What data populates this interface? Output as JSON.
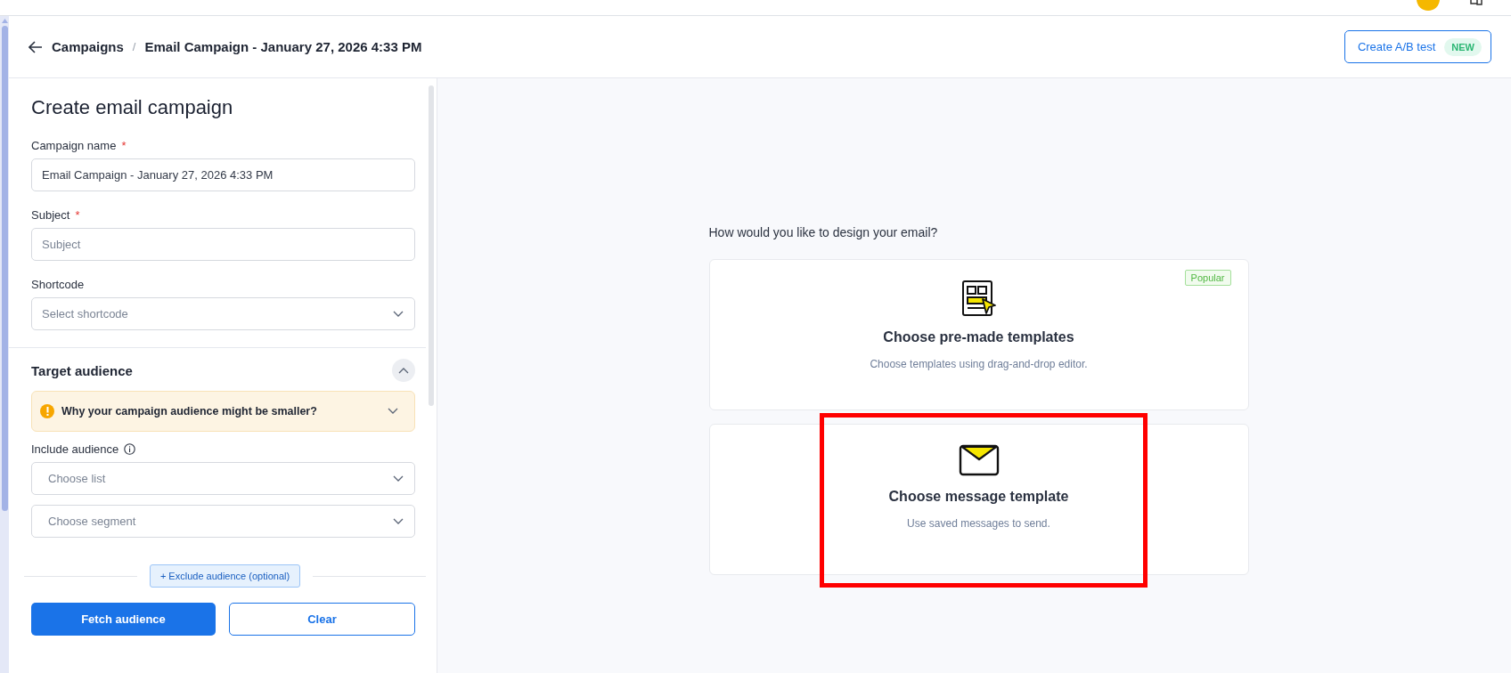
{
  "breadcrumb": {
    "separator": "/",
    "items": [
      {
        "label": "Campaigns"
      },
      {
        "label": "Email Campaign - January 27, 2026 4:33 PM"
      }
    ]
  },
  "ab_button": {
    "label": "Create A/B test",
    "badge": "NEW"
  },
  "form": {
    "title": "Create email campaign",
    "fields": [
      {
        "kind": "input",
        "label": "Campaign name",
        "required_mark": "*",
        "value": "Email Campaign - January 27, 2026 4:33 PM"
      },
      {
        "kind": "input",
        "label": "Subject",
        "required_mark": "*",
        "placeholder": "Subject"
      },
      {
        "kind": "select",
        "label": "Shortcode",
        "placeholder": "Select shortcode"
      }
    ]
  },
  "audience": {
    "title": "Target audience",
    "expanded": true,
    "alert": "Why your campaign audience might be smaller?",
    "include_label": "Include audience",
    "selects": [
      {
        "placeholder": "Choose list"
      },
      {
        "placeholder": "Choose segment"
      }
    ],
    "exclude_button": "+ Exclude audience (optional)",
    "buttons": [
      {
        "label": "Fetch audience",
        "kind": "primary"
      },
      {
        "label": "Clear",
        "kind": "secondary"
      }
    ]
  },
  "design": {
    "question": "How would you like to design your email?",
    "options": [
      {
        "kind": "layout",
        "title": "Choose pre-made templates",
        "description": "Choose templates using drag-and-drop editor.",
        "badge": "Popular",
        "highlighted": false
      },
      {
        "kind": "envelope",
        "title": "Choose message template",
        "description": "Use saved messages to send.",
        "highlighted": true
      }
    ]
  }
}
